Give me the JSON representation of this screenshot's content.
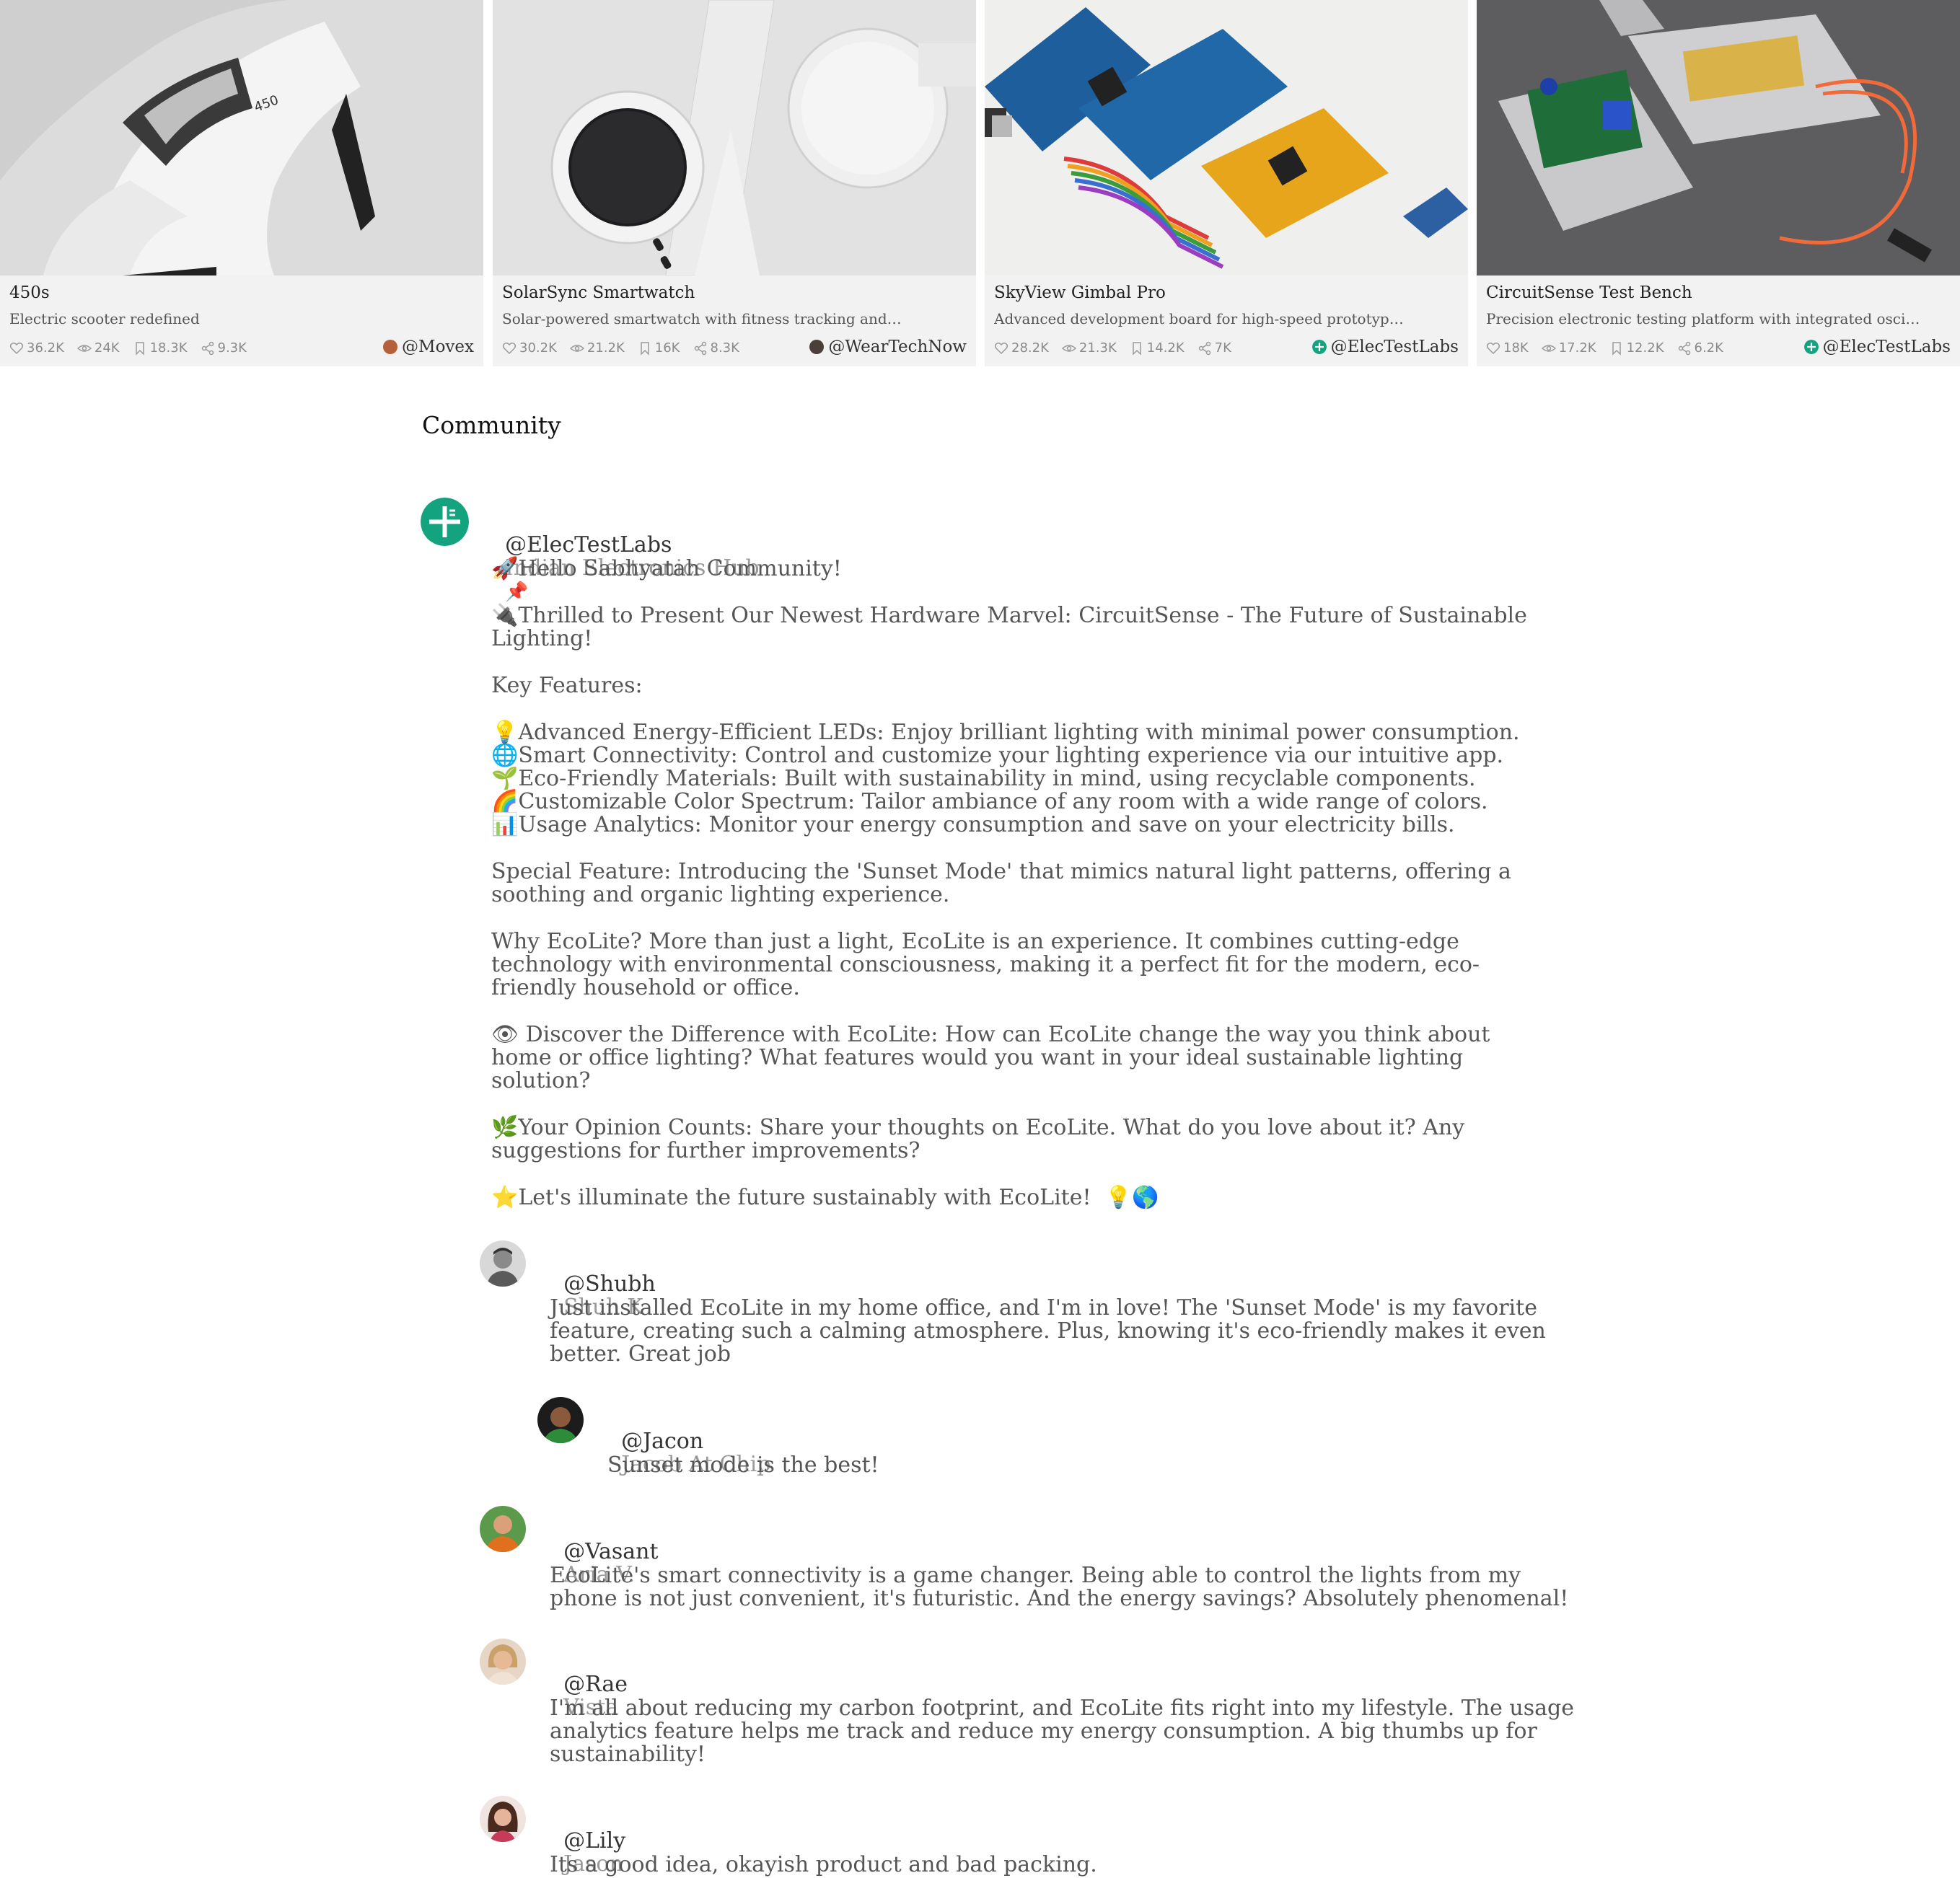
{
  "cards": [
    {
      "title": "450s",
      "description": "Electric scooter redefined",
      "likes": "36.2K",
      "views": "24K",
      "saves": "18.3K",
      "shares": "9.3K",
      "author": "@Movex",
      "image": "white-electric-scooter"
    },
    {
      "title": "SolarSync Smartwatch",
      "description": "Solar-powered smartwatch with fitness tracking and smartphone connectivity",
      "likes": "30.2K",
      "views": "21.2K",
      "saves": "16K",
      "shares": "8.3K",
      "author": "@WearTechNow",
      "image": "white-smartwatch"
    },
    {
      "title": "SkyView Gimbal Pro",
      "description": "Advanced development board for high-speed prototyping and testing",
      "likes": "28.2K",
      "views": "21.3K",
      "saves": "14.2K",
      "shares": "7K",
      "author": "@ElecTestLabs",
      "image": "arduino-boards"
    },
    {
      "title": "CircuitSense Test Bench",
      "description": "Precision electronic testing platform with integrated oscilloscope",
      "likes": "18K",
      "views": "17.2K",
      "saves": "12.2K",
      "shares": "6.2K",
      "author": "@ElecTestLabs",
      "image": "test-bench"
    }
  ],
  "community": {
    "title": "Community",
    "post": {
      "username": "@ElecTestLabs",
      "fullname": "Indian Electronics Hub",
      "pin": "📌",
      "lines": [
        "🚀Hello Sabhyatah Community!",
        "🔌Thrilled to Present Our Newest Hardware Marvel: CircuitSense - The Future of Sustainable",
        "Lighting!",
        "Key Features:",
        "💡Advanced Energy-Efficient LEDs: Enjoy brilliant lighting with minimal power consumption.",
        "🌐Smart Connectivity: Control and customize your lighting experience via our intuitive app.",
        "🌱Eco-Friendly Materials: Built with sustainability in mind, using recyclable components.",
        "🌈Customizable Color Spectrum: Tailor ambiance of any room with a wide range of colors.",
        "📊Usage Analytics: Monitor your energy consumption and save on your electricity bills.",
        "Special Feature: Introducing the 'Sunset Mode' that mimics natural light patterns, offering a",
        "soothing and organic lighting experience.",
        "Why EcoLite? More than just a light, EcoLite is an experience. It combines cutting-edge",
        "technology with environmental consciousness, making it a perfect fit for the modern, eco-",
        "friendly household or office.",
        "👁 Discover the Difference with EcoLite: How can EcoLite change the way you think about",
        "home or office lighting? What features would you want in your ideal sustainable lighting",
        "solution?",
        "🌿Your Opinion Counts: Share your thoughts on EcoLite. What do you love about it? Any",
        "suggestions for further improvements?",
        "⭐Let's illuminate the future sustainably with EcoLite!  💡🌎"
      ]
    },
    "comments": [
      {
        "username": "@Shubh",
        "fullname": "Shuh K",
        "lines": [
          "Just installed EcoLite in my home office, and I'm in love! The 'Sunset Mode' is my favorite",
          "feature, creating such a calming atmosphere. Plus, knowing it's eco-friendly makes it even",
          "better. Great job"
        ]
      },
      {
        "username": "@Jacon",
        "fullname": "Jacob At Chip",
        "lines": [
          "Sunset mode is the best!"
        ]
      },
      {
        "username": "@Vasant",
        "fullname": "Aria V.",
        "lines": [
          "EcoLite's smart connectivity is a game changer. Being able to control the lights from my",
          "phone is not just convenient, it's futuristic. And the energy savings? Absolutely phenomenal!"
        ]
      },
      {
        "username": "@Rae",
        "fullname": "Vista",
        "lines": [
          "I'm all about reducing my carbon footprint, and EcoLite fits right into my lifestyle. The usage",
          "analytics feature helps me track and reduce my energy consumption. A big thumbs up for",
          "sustainability!"
        ]
      },
      {
        "username": "@Lily",
        "fullname": "Jason",
        "lines": [
          "Its a good idea, okayish product and bad packing."
        ]
      }
    ]
  },
  "colors": {
    "brand_green": "#13a37f",
    "card_bg": "#f2f2f2"
  }
}
